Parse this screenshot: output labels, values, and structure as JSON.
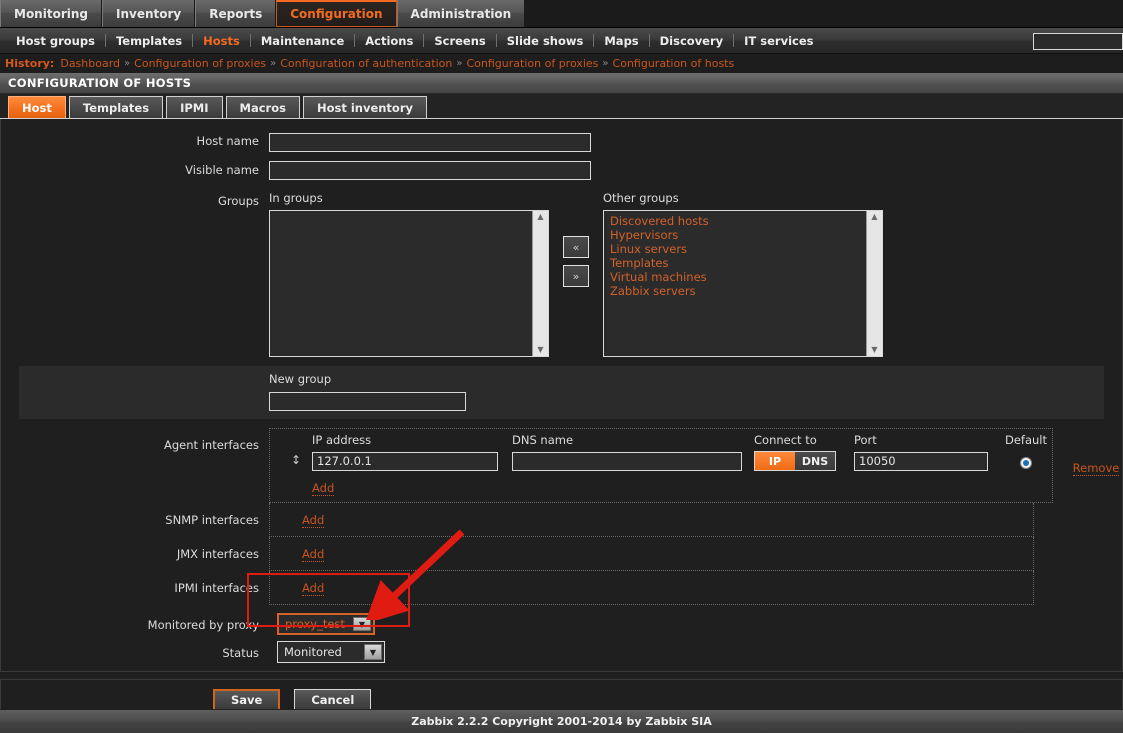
{
  "topmenu": {
    "items": [
      {
        "label": "Monitoring",
        "selected": false
      },
      {
        "label": "Inventory",
        "selected": false
      },
      {
        "label": "Reports",
        "selected": false
      },
      {
        "label": "Configuration",
        "selected": true
      },
      {
        "label": "Administration",
        "selected": false
      }
    ]
  },
  "submenu": {
    "items": [
      {
        "label": "Host groups",
        "selected": false
      },
      {
        "label": "Templates",
        "selected": false
      },
      {
        "label": "Hosts",
        "selected": true
      },
      {
        "label": "Maintenance",
        "selected": false
      },
      {
        "label": "Actions",
        "selected": false
      },
      {
        "label": "Screens",
        "selected": false
      },
      {
        "label": "Slide shows",
        "selected": false
      },
      {
        "label": "Maps",
        "selected": false
      },
      {
        "label": "Discovery",
        "selected": false
      },
      {
        "label": "IT services",
        "selected": false
      }
    ],
    "search": {
      "value": "",
      "placeholder": ""
    }
  },
  "history": {
    "label": "History:",
    "separator": "»",
    "items": [
      "Dashboard",
      "Configuration of proxies",
      "Configuration of authentication",
      "Configuration of proxies",
      "Configuration of hosts"
    ]
  },
  "page": {
    "title": "CONFIGURATION OF HOSTS"
  },
  "tabs": [
    {
      "label": "Host",
      "selected": true
    },
    {
      "label": "Templates",
      "selected": false
    },
    {
      "label": "IPMI",
      "selected": false
    },
    {
      "label": "Macros",
      "selected": false
    },
    {
      "label": "Host inventory",
      "selected": false
    }
  ],
  "form": {
    "host_name": {
      "label": "Host name",
      "value": "",
      "placeholder": ""
    },
    "visible_name": {
      "label": "Visible name",
      "value": "",
      "placeholder": ""
    },
    "groups": {
      "label": "Groups",
      "in_groups_caption": "In groups",
      "in_groups": [],
      "other_groups_caption": "Other groups",
      "other_groups": [
        "Discovered hosts",
        "Hypervisors",
        "Linux servers",
        "Templates",
        "Virtual machines",
        "Zabbix servers"
      ],
      "move_left_label": "«",
      "move_right_label": "»"
    },
    "new_group": {
      "label": "New group",
      "value": "",
      "placeholder": ""
    },
    "agent_interfaces": {
      "label": "Agent interfaces",
      "headers": {
        "ip": "IP address",
        "dns": "DNS name",
        "connect_to": "Connect to",
        "port": "Port",
        "default": "Default"
      },
      "rows": [
        {
          "drag_handle": "↕",
          "ip": "127.0.0.1",
          "dns": "",
          "connect_ip": "IP",
          "connect_dns": "DNS",
          "connect_selected": "IP",
          "port": "10050",
          "default_checked": true,
          "remove_label": "Remove"
        }
      ],
      "add_label": "Add"
    },
    "snmp_interfaces": {
      "label": "SNMP interfaces",
      "add_label": "Add"
    },
    "jmx_interfaces": {
      "label": "JMX interfaces",
      "add_label": "Add"
    },
    "ipmi_interfaces": {
      "label": "IPMI interfaces",
      "add_label": "Add"
    },
    "monitored_by_proxy": {
      "label": "Monitored by proxy",
      "value": "proxy_test",
      "focused": true
    },
    "status": {
      "label": "Status",
      "value": "Monitored",
      "focused": false
    },
    "buttons": {
      "save": "Save",
      "cancel": "Cancel"
    }
  },
  "footer": {
    "copyright": "Zabbix 2.2.2 Copyright 2001-2014 by Zabbix SIA"
  },
  "colors": {
    "accent_orange": "#f36b21",
    "link_orange": "#c8551d",
    "annotation_red": "#e01b12",
    "background": "#1f1f1f"
  }
}
